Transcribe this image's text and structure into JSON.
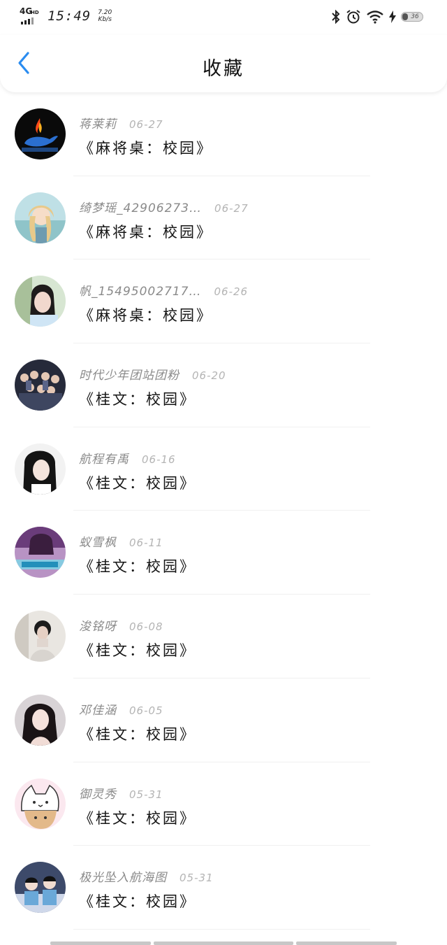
{
  "status_bar": {
    "network": "4G",
    "network_sup": "HD",
    "time": "15:49",
    "speed_value": "7.20",
    "speed_unit": "Kb/s",
    "battery": "36",
    "icons": [
      "bluetooth-icon",
      "alarm-icon",
      "wifi-icon",
      "charging-icon",
      "battery-icon"
    ]
  },
  "header": {
    "back_icon": "chevron-left-icon",
    "title": "收藏",
    "accent_color": "#2a8cf0"
  },
  "favorites": [
    {
      "name": "蒋莱莉",
      "date": "06-27",
      "work": "《麻将桌：校园》",
      "avatar": "avatar-flame-whale"
    },
    {
      "name": "绮梦瑶_42906273…",
      "date": "06-27",
      "work": "《麻将桌：校园》",
      "avatar": "avatar-anime-girl"
    },
    {
      "name": "帆_15495002717…",
      "date": "06-26",
      "work": "《麻将桌：校园》",
      "avatar": "avatar-girl-portrait"
    },
    {
      "name": "时代少年团站团粉",
      "date": "06-20",
      "work": "《桂文：校园》",
      "avatar": "avatar-group-photo"
    },
    {
      "name": "航程有禹",
      "date": "06-16",
      "work": "《桂文：校园》",
      "avatar": "avatar-girl-dark-hair"
    },
    {
      "name": "蚁雪枫",
      "date": "06-11",
      "work": "《桂文：校园》",
      "avatar": "avatar-purple-photo"
    },
    {
      "name": "浚铭呀",
      "date": "06-08",
      "work": "《桂文：校园》",
      "avatar": "avatar-boy-photo"
    },
    {
      "name": "邓佳涵",
      "date": "06-05",
      "work": "《桂文：校园》",
      "avatar": "avatar-girl-long-hair"
    },
    {
      "name": "御灵秀",
      "date": "05-31",
      "work": "《桂文：校园》",
      "avatar": "avatar-cat-cartoon"
    },
    {
      "name": "极光坠入航海图",
      "date": "05-31",
      "work": "《桂文：校园》",
      "avatar": "avatar-two-boys"
    }
  ]
}
